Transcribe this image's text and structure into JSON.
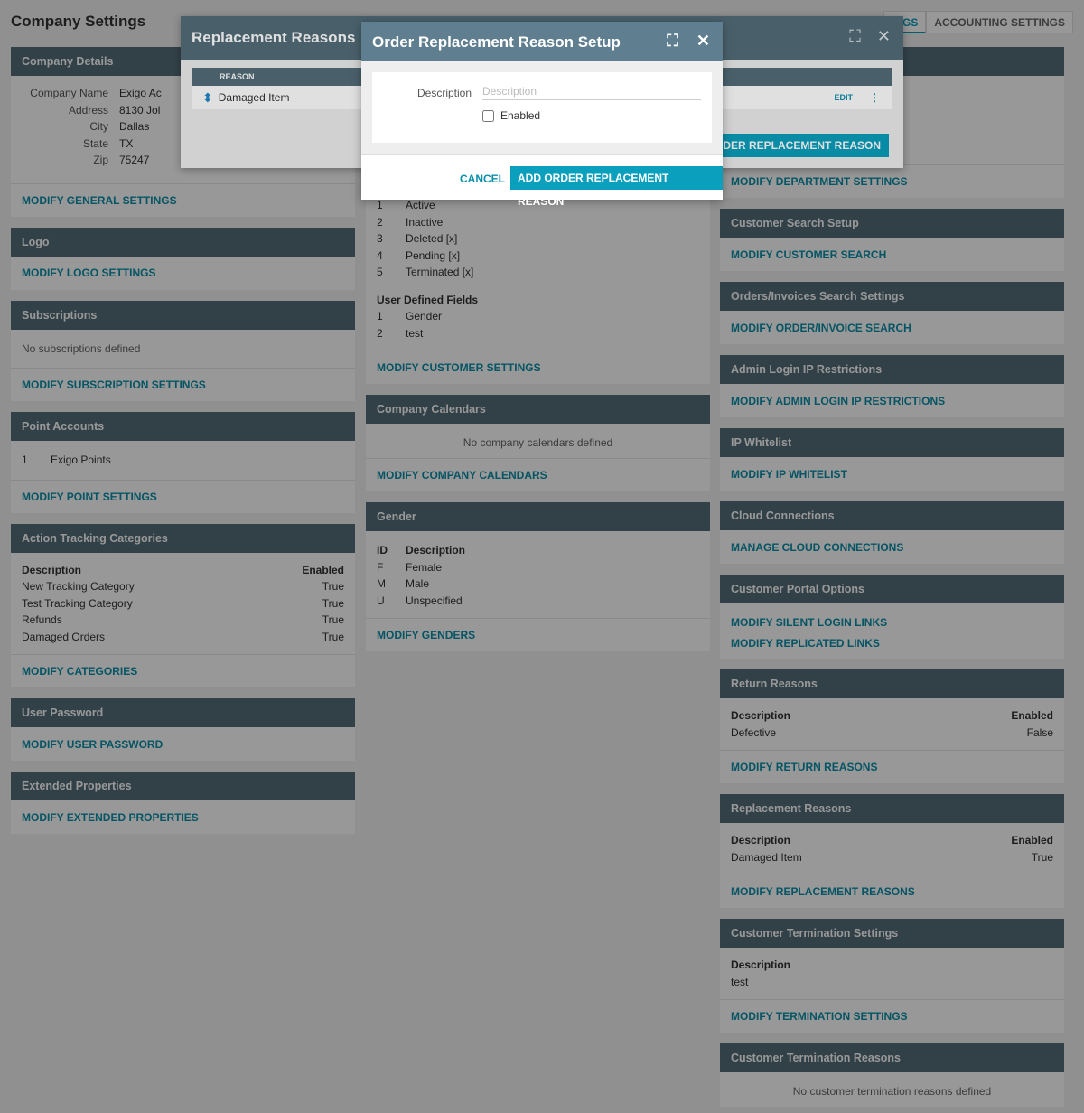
{
  "page": {
    "title": "Company Settings"
  },
  "tabs": [
    "INGS",
    "ACCOUNTING SETTINGS"
  ],
  "company_details": {
    "title": "Company Details",
    "fields": [
      {
        "label": "Company Name",
        "value": "Exigo Ac"
      },
      {
        "label": "Address",
        "value": "8130 Jol"
      },
      {
        "label": "City",
        "value": "Dallas"
      },
      {
        "label": "State",
        "value": "TX"
      },
      {
        "label": "Zip",
        "value": "75247"
      }
    ],
    "link": "MODIFY GENERAL SETTINGS"
  },
  "logo": {
    "title": "Logo",
    "link": "MODIFY LOGO SETTINGS"
  },
  "subscriptions": {
    "title": "Subscriptions",
    "empty": "No subscriptions defined",
    "link": "MODIFY SUBSCRIPTION SETTINGS"
  },
  "point_accounts": {
    "title": "Point Accounts",
    "rows": [
      {
        "id": "1",
        "name": "Exigo Points"
      }
    ],
    "link": "MODIFY POINT SETTINGS"
  },
  "action_tracking": {
    "title": "Action Tracking Categories",
    "col1": "Description",
    "col2": "Enabled",
    "rows": [
      {
        "d": "New Tracking Category",
        "e": "True"
      },
      {
        "d": "Test Tracking Category",
        "e": "True"
      },
      {
        "d": "Refunds",
        "e": "True"
      },
      {
        "d": "Damaged Orders",
        "e": "True"
      }
    ],
    "link": "MODIFY CATEGORIES"
  },
  "user_password": {
    "title": "User Password",
    "link": "MODIFY USER PASSWORD"
  },
  "extended_properties": {
    "title": "Extended Properties",
    "link": "MODIFY EXTENDED PROPERTIES"
  },
  "customer_statuses": [
    {
      "id": "1",
      "d": "Active"
    },
    {
      "id": "2",
      "d": "Inactive"
    },
    {
      "id": "3",
      "d": "Deleted [x]"
    },
    {
      "id": "4",
      "d": "Pending [x]"
    },
    {
      "id": "5",
      "d": "Terminated [x]"
    }
  ],
  "user_defined": {
    "title": "User Defined Fields",
    "rows": [
      {
        "id": "1",
        "d": "Gender"
      },
      {
        "id": "2",
        "d": "test"
      }
    ]
  },
  "customer_link": "MODIFY CUSTOMER SETTINGS",
  "calendars": {
    "title": "Company Calendars",
    "empty": "No company calendars defined",
    "link": "MODIFY COMPANY CALENDARS"
  },
  "gender": {
    "title": "Gender",
    "col1": "ID",
    "col2": "Description",
    "rows": [
      {
        "id": "F",
        "d": "Female"
      },
      {
        "id": "M",
        "d": "Male"
      },
      {
        "id": "U",
        "d": "Unspecified"
      }
    ],
    "link": "MODIFY GENDERS"
  },
  "department_link": "MODIFY DEPARTMENT SETTINGS",
  "customer_search": {
    "title": "Customer Search Setup",
    "link": "MODIFY CUSTOMER SEARCH"
  },
  "orders_search": {
    "title": "Orders/Invoices Search Settings",
    "link": "MODIFY ORDER/INVOICE SEARCH"
  },
  "admin_ip": {
    "title": "Admin Login IP Restrictions",
    "link": "MODIFY ADMIN LOGIN IP RESTRICTIONS"
  },
  "ip_whitelist": {
    "title": "IP Whitelist",
    "link": "MODIFY IP WHITELIST"
  },
  "cloud": {
    "title": "Cloud Connections",
    "link": "MANAGE CLOUD CONNECTIONS"
  },
  "portal": {
    "title": "Customer Portal Options",
    "link1": "MODIFY SILENT LOGIN LINKS",
    "link2": "MODIFY REPLICATED LINKS"
  },
  "return_reasons": {
    "title": "Return Reasons",
    "col1": "Description",
    "col2": "Enabled",
    "rows": [
      {
        "d": "Defective",
        "e": "False"
      }
    ],
    "link": "MODIFY RETURN REASONS"
  },
  "replacement_reasons": {
    "title": "Replacement Reasons",
    "col1": "Description",
    "col2": "Enabled",
    "rows": [
      {
        "d": "Damaged Item",
        "e": "True"
      }
    ],
    "link": "MODIFY REPLACEMENT REASONS"
  },
  "termination_settings": {
    "title": "Customer Termination Settings",
    "col1": "Description",
    "value": "test",
    "link": "MODIFY TERMINATION SETTINGS"
  },
  "termination_reasons": {
    "title": "Customer Termination Reasons",
    "empty": "No customer termination reasons defined"
  },
  "rr_window": {
    "title": "Replacement Reasons",
    "col": "REASON",
    "row": "Damaged Item",
    "edit": "EDIT",
    "add": "ORDER REPLACEMENT REASON"
  },
  "modal": {
    "title": "Order Replacement Reason Setup",
    "desc_label": "Description",
    "desc_placeholder": "Description",
    "enabled_label": "Enabled",
    "cancel": "CANCEL",
    "add": "ADD ORDER REPLACEMENT REASON"
  }
}
